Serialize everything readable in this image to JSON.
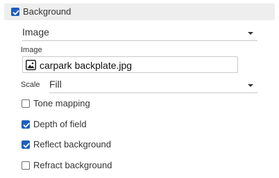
{
  "background": {
    "checked": true,
    "label": "Background"
  },
  "source_select": {
    "value": "Image"
  },
  "image": {
    "label": "Image",
    "file_name": "carpark backplate.jpg",
    "icon": "image-icon"
  },
  "scale": {
    "label": "Scale",
    "value": "Fill"
  },
  "options": [
    {
      "label": "Tone mapping",
      "checked": false
    },
    {
      "label": "Depth of field",
      "checked": true
    },
    {
      "label": "Reflect background",
      "checked": true
    },
    {
      "label": "Refract background",
      "checked": false
    }
  ],
  "colors": {
    "accent": "#1d5fbf",
    "header_bg": "#eeeeee"
  }
}
